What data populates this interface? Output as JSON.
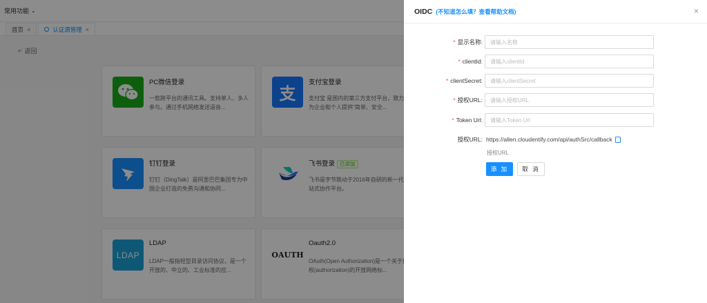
{
  "topbar": {
    "menu_label": "常用功能",
    "menu_chevron": "⌄"
  },
  "tabs": [
    {
      "label": "首页",
      "close": "×"
    },
    {
      "label": "认证源管理",
      "close": "×"
    }
  ],
  "back_label": "返回",
  "cards": [
    {
      "title": "PC微信登录",
      "desc": "一款跨平台的通讯工具。支持单人、多人参与。通过手机网络发送语音...",
      "icon": "wechat-icon"
    },
    {
      "title": "支付宝登录",
      "desc": "支付宝 是国内的第三方支付平台，致力于为企业和个人提供\"简单、安全...",
      "icon": "alipay-icon"
    },
    {
      "title": "钉钉登录",
      "desc": "钉钉（DingTalk）是阿里巴巴集团专为中国企业打造的免费沟通和协同...",
      "icon": "dingtalk-icon"
    },
    {
      "title": "飞书登录",
      "badge": "已添加",
      "desc": "飞书是字节跳动于2016年自研的新一代一站式协作平台。",
      "icon": "feishu-icon"
    },
    {
      "title": "LDAP",
      "logo_text": "LDAP",
      "desc": "LDAP一般指轻型目录访问协议，是一个开放的、中立的、工业标准的应...",
      "icon": "ldap-icon"
    },
    {
      "title": "Oauth2.0",
      "logo_text": "OAUTH",
      "desc": "OAuth(Open Authorization)是一个关于授权(authorization)的开放网络标...",
      "icon": "oauth-icon"
    }
  ],
  "drawer": {
    "title": "OIDC",
    "help_link": "(不知道怎么填？查看帮助文档)",
    "close": "×",
    "fields": [
      {
        "label": "显示名称:",
        "required": "*",
        "placeholder": "请输入名称"
      },
      {
        "label": "clientId:",
        "required": "*",
        "placeholder": "请输入clientId"
      },
      {
        "label": "clientSecret:",
        "required": "*",
        "placeholder": "请输入clientSecret"
      },
      {
        "label": "授权URL:",
        "required": "*",
        "placeholder": "请输入授权URL"
      },
      {
        "label": "Token Url:",
        "required": "*",
        "placeholder": "请输入Token Url"
      }
    ],
    "callback": {
      "label": "授权URL:",
      "value": "https://allen.cloudentify.com/api/authSrc/callback"
    },
    "hint": "授权URL",
    "add_button": "添 加",
    "cancel_button": "取 消"
  },
  "colors": {
    "primary": "#1890ff",
    "required": "#ff4d4f",
    "wechat": "#1aad19",
    "alipay": "#1677ff",
    "ldap": "#1aa0d8"
  }
}
